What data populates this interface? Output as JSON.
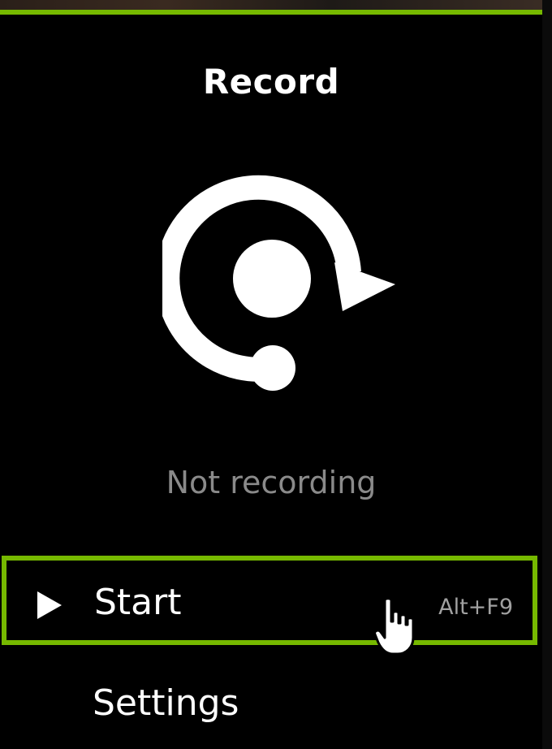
{
  "panel": {
    "title": "Record",
    "status": "Not recording",
    "accent_color": "#76b900"
  },
  "menu": {
    "start": {
      "label": "Start",
      "shortcut": "Alt+F9",
      "icon": "play-icon",
      "highlighted": true
    },
    "settings": {
      "label": "Settings"
    }
  },
  "icons": {
    "record": "record-icon",
    "cursor": "hand-pointer-icon"
  }
}
